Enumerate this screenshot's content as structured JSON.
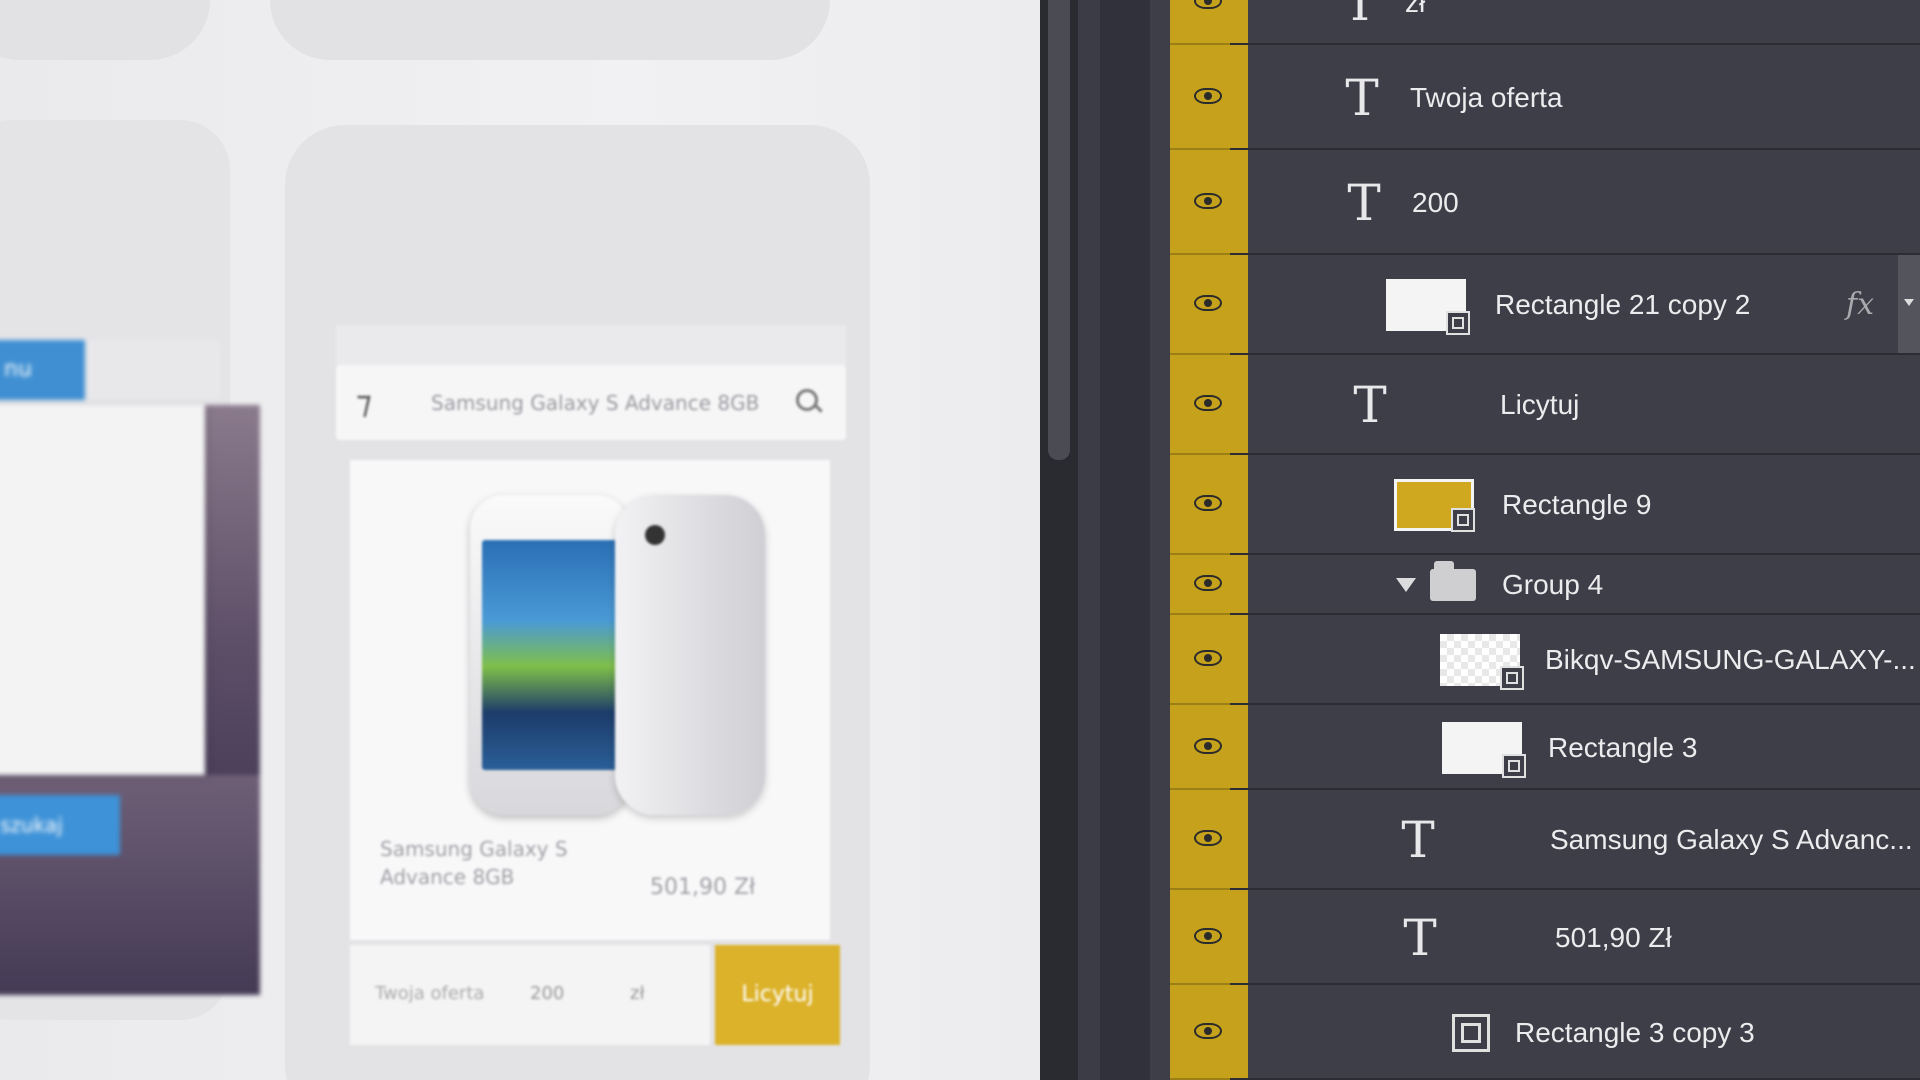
{
  "canvas": {
    "left_phone": {
      "menu_button_label": "nu",
      "cta_label": "szukaj",
      "menu_items": [
        "...",
        "...",
        "..."
      ]
    },
    "main_phone": {
      "search_text": "Samsung Galaxy S Advance 8GB",
      "product_name": "Samsung Galaxy S Advance 8GB",
      "product_price": "501,90 Zł",
      "offer_label": "Twoja oferta",
      "offer_amount": "200",
      "offer_currency": "zł",
      "bid_button": "Licytuj"
    }
  },
  "layers": [
    {
      "name": "zł",
      "type": "text",
      "visible": true
    },
    {
      "name": "Twoja oferta",
      "type": "text",
      "visible": true
    },
    {
      "name": "200",
      "type": "text",
      "visible": true
    },
    {
      "name": "Rectangle 21 copy 2",
      "type": "shape",
      "thumb": "white",
      "visible": true,
      "fx": "fx"
    },
    {
      "name": "Licytuj",
      "type": "text",
      "visible": true
    },
    {
      "name": "Rectangle 9",
      "type": "shape",
      "thumb": "gold",
      "visible": true
    },
    {
      "name": "Group 4",
      "type": "group",
      "visible": true,
      "expanded": true
    },
    {
      "name": "Bikqv-SAMSUNG-GALAXY-...",
      "type": "smart",
      "thumb": "transparent",
      "visible": true
    },
    {
      "name": "Rectangle 3",
      "type": "shape",
      "thumb": "white",
      "visible": true
    },
    {
      "name": "Samsung Galaxy S Advanc...",
      "type": "text",
      "visible": true
    },
    {
      "name": "501,90 Zł",
      "type": "text",
      "visible": true
    },
    {
      "name": "Rectangle 3 copy 3",
      "type": "shape-only",
      "visible": true
    }
  ],
  "colors": {
    "accent_gold": "#c6a21c",
    "panel_bg": "#3d3e47",
    "blue": "#3f8fd2"
  },
  "icons": {
    "visibility": "eye-icon",
    "text_layer": "T",
    "shape_layer": "vector-mask-icon",
    "group": "folder-icon"
  }
}
